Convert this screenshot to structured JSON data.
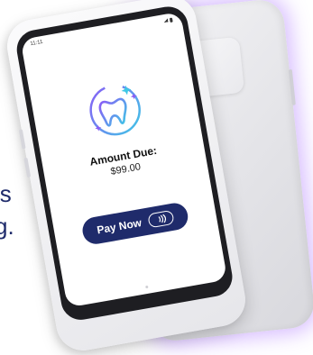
{
  "marketing_text": {
    "line1": "is",
    "line2": "g."
  },
  "status_bar": {
    "time": "11:11"
  },
  "payment_screen": {
    "icon": "tooth-icon",
    "amount_label": "Amount Due:",
    "amount_value": "$99.00",
    "pay_button_label": "Pay Now",
    "contactless_icon": "nfc-icon"
  },
  "colors": {
    "brand_navy": "#1f2b6b",
    "tooth_gradient_start": "#8a5cf6",
    "tooth_gradient_end": "#3ec8e6",
    "glow": "#a86eff"
  }
}
